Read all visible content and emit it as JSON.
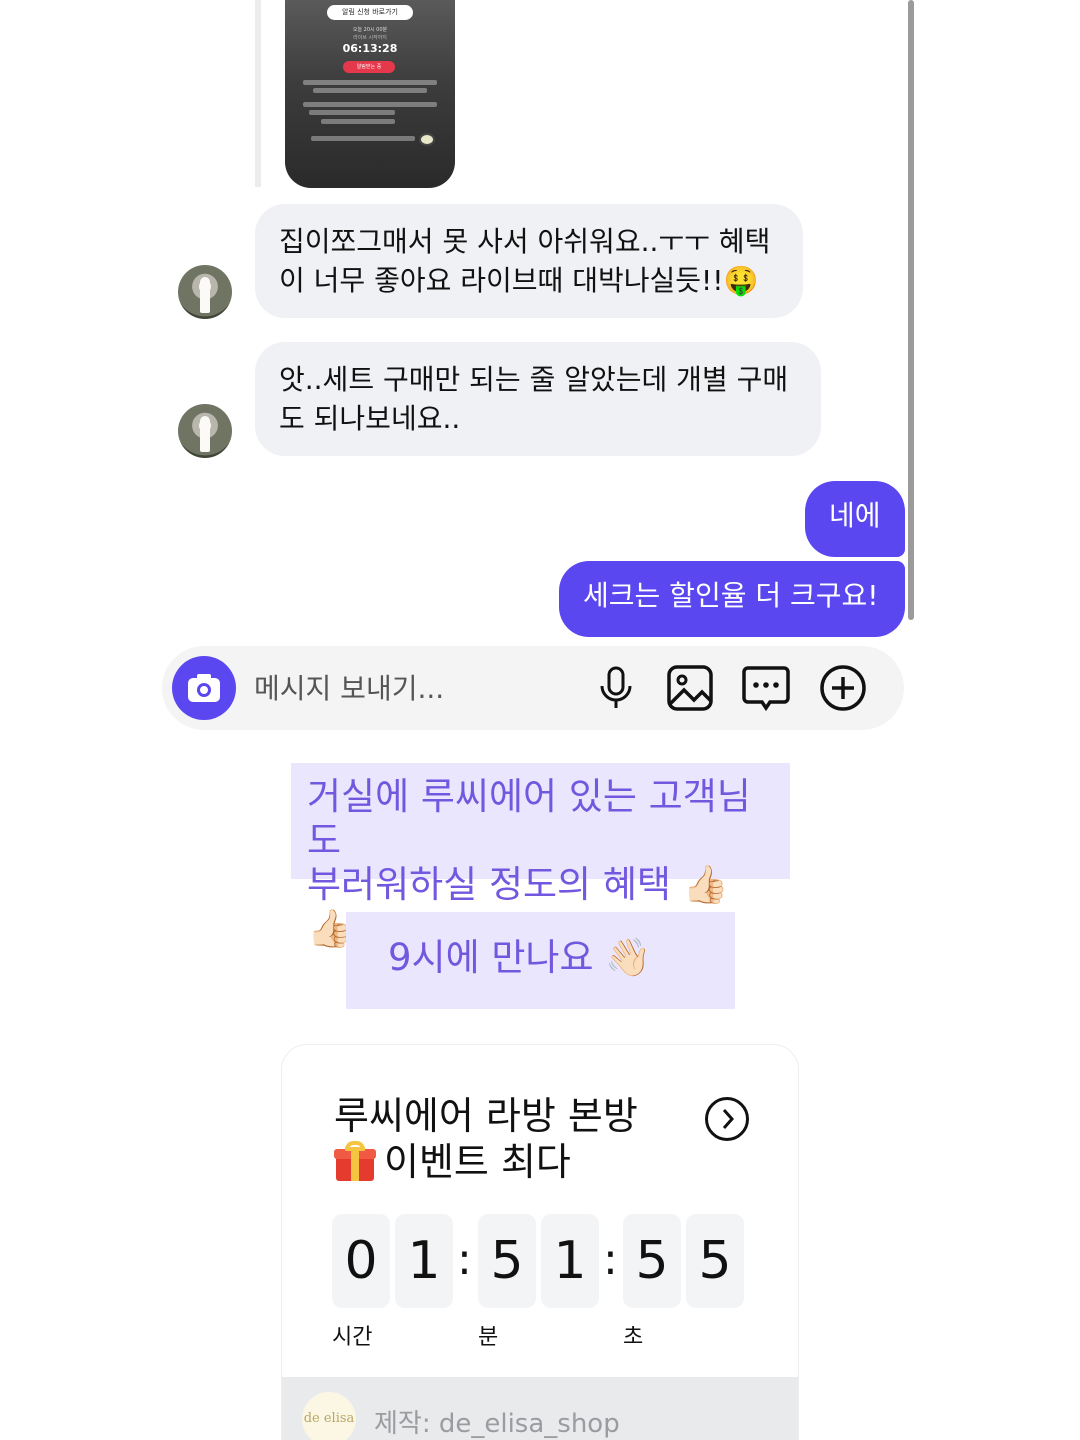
{
  "story_preview": {
    "pill": "알림 신청 바로가기",
    "line1": "오늘 20시 00분",
    "line2": "라이브 시작까지",
    "time": "06:13:28",
    "button": "알림받는 중"
  },
  "messages": [
    {
      "side": "in",
      "text_line1": "집이쪼그매서 못 사서 아쉬워요..ㅜㅜ 혜택",
      "text_line2": "이 너무 좋아요 라이브때 대박나실듯!!🤑"
    },
    {
      "side": "in",
      "text_line1": "앗..세트 구매만 되는 줄 알았는데 개별 구매",
      "text_line2": "도 되나보네요.."
    },
    {
      "side": "out",
      "text": "네에"
    },
    {
      "side": "out",
      "text": "세크는 할인율 더 크구요!"
    }
  ],
  "composer": {
    "placeholder": "메시지 보내기..."
  },
  "captions": {
    "caption1_line1": "거실에 루씨에어 있는 고객님도",
    "caption1_line2": "부러워하실 정도의 혜택 👍🏻👍🏻",
    "caption2": "9시에 만나요 👋🏻"
  },
  "countdown": {
    "title_line1": "루씨에어 라방 본방",
    "title_line2": "이벤트 최다",
    "digits": [
      "0",
      "1",
      "5",
      "1",
      "5",
      "5"
    ],
    "separator": ":",
    "units": [
      "시간",
      "분",
      "초"
    ],
    "footer_logo": "de elisa",
    "footer_text": "제작: de_elisa_shop"
  },
  "colors": {
    "accent": "#5b47f0",
    "caption_bg": "#e9e6fd",
    "caption_text": "#7257df",
    "bubble_in": "#eff1f4"
  }
}
